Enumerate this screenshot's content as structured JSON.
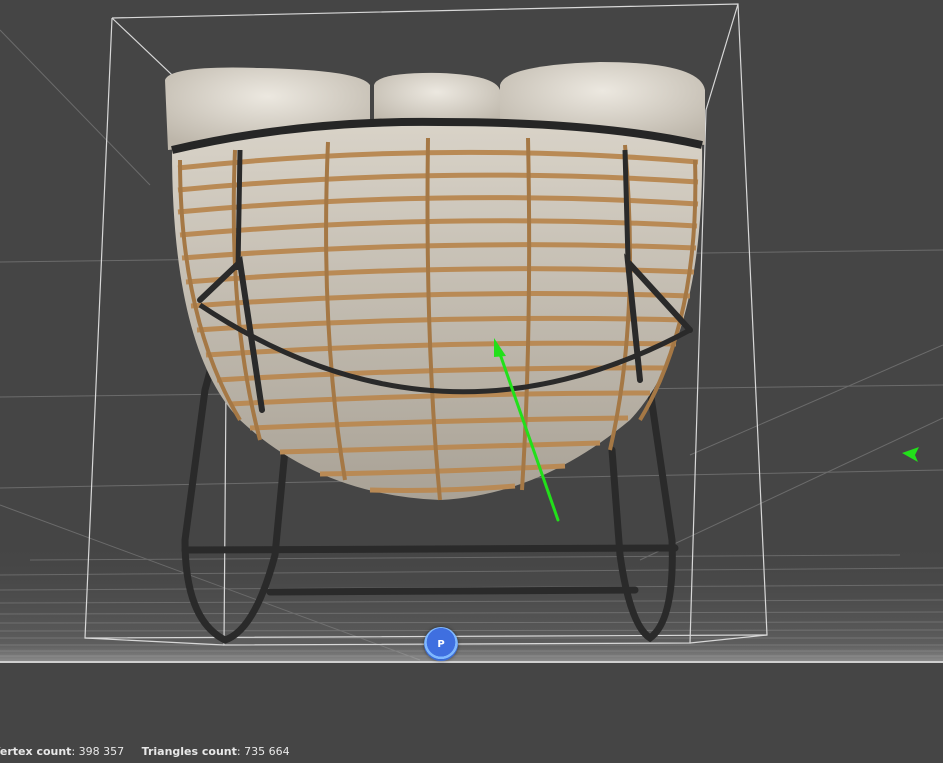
{
  "viewport": {
    "background": "#454545",
    "model_name": "rocking chair",
    "pivot_label": "P",
    "gizmo_color": "#22e01a"
  },
  "status_bar": {
    "vertex_label": "Vertex count",
    "vertex_value": ": 398 357",
    "triangles_label": "Triangles count",
    "triangles_value": ": 735 664"
  }
}
